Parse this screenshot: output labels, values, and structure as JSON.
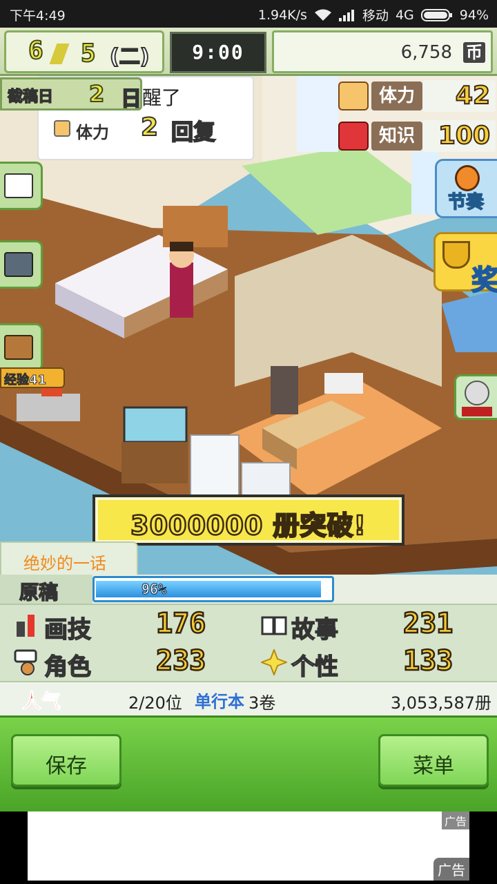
{
  "status_bar": {
    "time": "下午4:49",
    "net_speed": "1.94K/s",
    "carrier": "移动",
    "network": "4G",
    "battery": "94%"
  },
  "top_bar": {
    "month": "6",
    "day": "5",
    "weekday": "(二)",
    "clock": "9:00",
    "money": "6,758",
    "currency_symbol": "币"
  },
  "deadline": {
    "label": "截稿日",
    "value": "2",
    "unit": "日"
  },
  "speech": {
    "text": "醒了",
    "stat_label": "体力",
    "stat_value": "2",
    "stat_unit": "回复"
  },
  "stats_panel": {
    "stamina_label": "体力",
    "stamina_value": "42",
    "knowledge_label": "知识",
    "knowledge_value": "100"
  },
  "right_buttons": {
    "rhythm_label": "节奏",
    "award_label": "奖"
  },
  "exp_badge": "经验41",
  "banner": "3000000 册突破!",
  "episode": "绝妙的一话",
  "manuscript": {
    "label": "原稿",
    "progress_text": "96%",
    "progress": 0.96
  },
  "attributes": {
    "drawing_label": "画技",
    "drawing_value": "176",
    "story_label": "故事",
    "story_value": "231",
    "character_label": "角色",
    "character_value": "233",
    "personality_label": "个性",
    "personality_value": "133"
  },
  "popularity": {
    "label": "人气",
    "rank": "2/20位",
    "volume_label": "单行本",
    "volumes": "3卷",
    "sales": "3,053,587册"
  },
  "bottom_buttons": {
    "save": "保存",
    "menu": "菜单"
  },
  "ad": {
    "tag": "广告",
    "tag2": "广告"
  },
  "colors": {
    "accent_green": "#4aa528",
    "number_yellow": "#f6cc3a",
    "progress_blue": "#2c90e0",
    "popularity_red": "#ff4a4a"
  }
}
